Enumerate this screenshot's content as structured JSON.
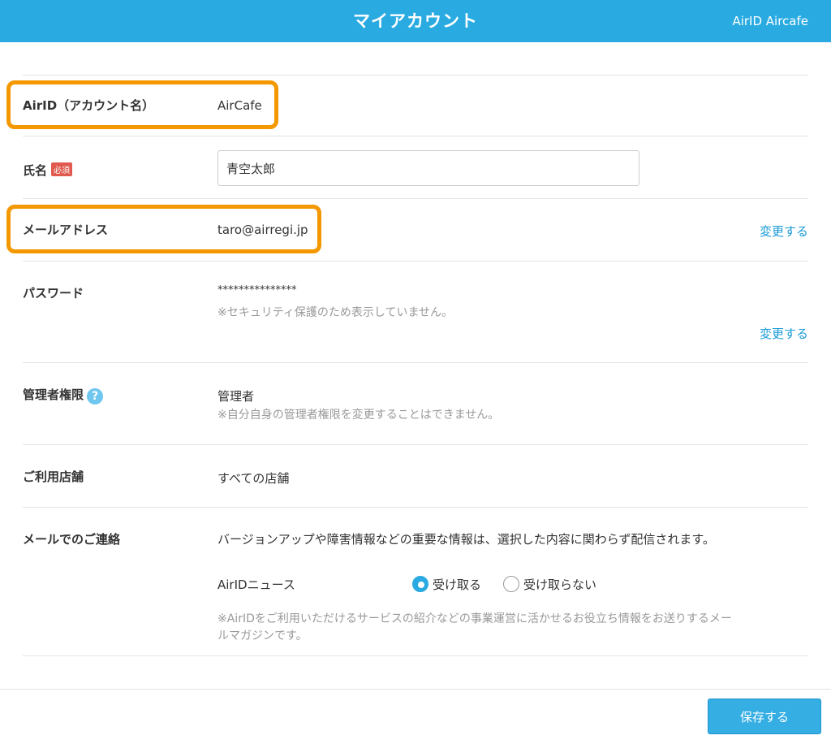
{
  "header": {
    "title": "マイアカウント",
    "user": "AirID Aircafe"
  },
  "account": {
    "airid_label": "AirID（アカウント名）",
    "airid_value": "AirCafe",
    "name_label": "氏名",
    "required_badge": "必須",
    "name_value": "青空太郎",
    "email_label": "メールアドレス",
    "email_value": "taro@airregi.jp",
    "email_change": "変更する",
    "password_label": "パスワード",
    "password_value": "***************",
    "password_note": "※セキュリティ保護のため表示していません。",
    "password_change": "変更する",
    "admin_label": "管理者権限",
    "admin_help": "?",
    "admin_value": "管理者",
    "admin_note": "※自分自身の管理者権限を変更することはできません。",
    "store_label": "ご利用店舗",
    "store_value": "すべての店舗",
    "mail_label": "メールでのご連絡",
    "mail_info": "バージョンアップや障害情報などの重要な情報は、選択した内容に関わらず配信されます。",
    "news_label": "AirIDニュース",
    "news_options": [
      "受け取る",
      "受け取らない"
    ],
    "news_selected": "受け取る",
    "news_note_line1": "※AirIDをご利用いただけるサービスの紹介などの事業運営に活かせるお役立ち情報をお送りするメー",
    "news_note_line2": "ルマガジンです。"
  },
  "footer": {
    "save_label": "保存する"
  },
  "colors": {
    "header_bg": "#29abe2",
    "link": "#1a9bd7",
    "highlight": "#f39800",
    "required": "#e05a4f"
  }
}
